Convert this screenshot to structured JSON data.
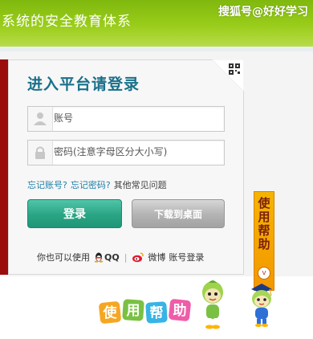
{
  "banner": {
    "title": "系统的安全教育体系",
    "watermark": "搜狐号@好好学习"
  },
  "login": {
    "title": "进入平台请登录",
    "username_placeholder": "账号",
    "password_placeholder": "密码(注意字母区分大小写)",
    "forgot_account": "忘记账号?",
    "forgot_password": "忘记密码?",
    "other_issues": "其他常见问题",
    "login_button": "登录",
    "download_button": "下载到桌面",
    "social_prefix": "你也可以使用",
    "qq_label": "QQ",
    "weibo_label": "微博",
    "social_suffix": "账号登录"
  },
  "help": {
    "tab_label": "使用帮助",
    "banner_text": "使用帮助"
  },
  "icons": [
    "qr-code-icon",
    "user-icon",
    "lock-icon",
    "qq-icon",
    "weibo-icon",
    "chevron-down-icon"
  ],
  "colors": {
    "banner_green": "#8cc21a",
    "title_teal": "#19708a",
    "link_blue": "#1f7fa8",
    "login_green": "#2aa584",
    "download_gray": "#b3b3b3",
    "help_orange": "#f39800",
    "accent_red": "#9b0c0c"
  }
}
